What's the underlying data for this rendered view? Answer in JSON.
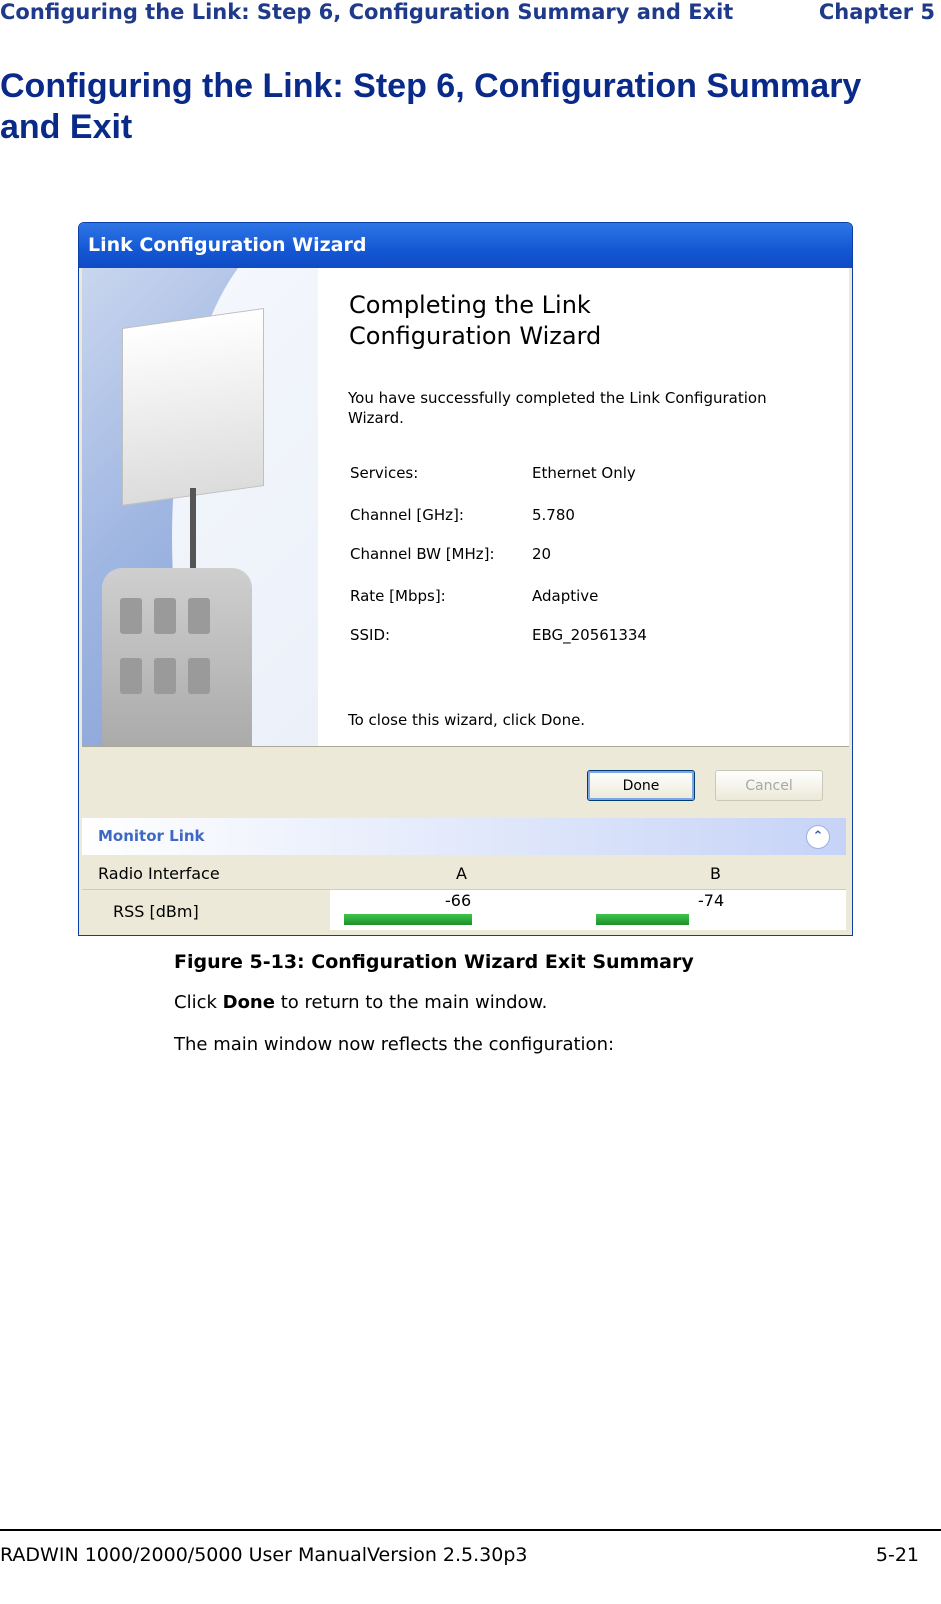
{
  "header": {
    "section": "Configuring the Link: Step 6, Configuration Summary and Exit",
    "chapter": "Chapter 5"
  },
  "page_title": "Configuring the Link: Step 6, Configuration Summary and Exit",
  "wizard": {
    "title": "Link Configuration Wizard",
    "heading": "Completing the Link Configuration Wizard",
    "intro": "You have successfully completed the Link Configuration Wizard.",
    "summary": [
      {
        "label": "Services:",
        "value": "Ethernet Only"
      },
      {
        "label": "Channel [GHz]:",
        "value": "5.780"
      },
      {
        "label": "Channel BW [MHz]:",
        "value": "20"
      },
      {
        "label": "Rate [Mbps]:",
        "value": "Adaptive"
      },
      {
        "label": "SSID:",
        "value": "EBG_20561334"
      }
    ],
    "close_note": "To close this wizard, click Done.",
    "done_label": "Done",
    "cancel_label": "Cancel"
  },
  "monitor": {
    "label": "Monitor Link",
    "columns": [
      "Radio Interface",
      "A",
      "B"
    ],
    "row_label": "RSS [dBm]",
    "values": [
      "-66",
      "-74"
    ]
  },
  "caption": "Figure 5-13: Configuration Wizard Exit Summary",
  "para1": {
    "pre": "Click ",
    "bold": "Done",
    "post": " to return to the main window."
  },
  "para2": "The main window now reflects the configuration:",
  "footer": {
    "left": "RADWIN 1000/2000/5000 User ManualVersion  2.5.30p3",
    "right": "5-21"
  }
}
